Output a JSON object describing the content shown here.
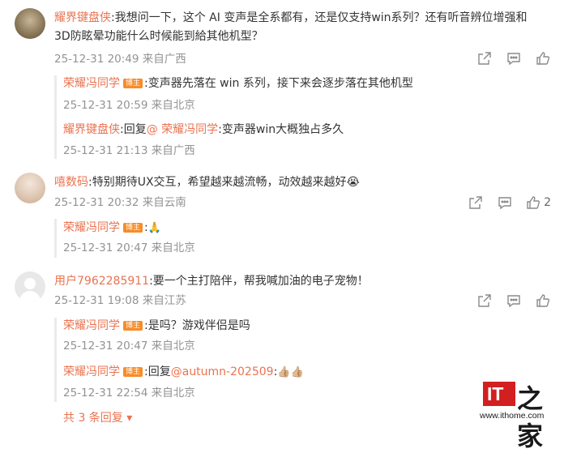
{
  "comments": [
    {
      "user": "耀界键盘侠",
      "text_line1": "我想问一下，这个 AI 变声是全系都有，还是仅支持win系列？还有听音辨位增强和",
      "text_line2": "3D防眩晕功能什么时候能到給其他机型？",
      "meta": "25-12-31 20:49 来自广西",
      "replies": [
        {
          "user": "荣耀冯同学",
          "badge": "博主",
          "text": "变声器先落在 win 系列，接下来会逐步落在其他机型",
          "meta": "25-12-31 20:59 来自北京"
        },
        {
          "user": "耀界键盘侠",
          "reply_prefix": "回复",
          "mention": "@ 荣耀冯同学",
          "text": "变声器win大概独占多久",
          "meta": "25-12-31 21:13 来自广西"
        }
      ]
    },
    {
      "user": "嘻数码",
      "text": "特别期待UX交互，希望越来越流畅，动效越来越好😭",
      "meta": "25-12-31 20:32 来自云南",
      "like_count": "2",
      "replies": [
        {
          "user": "荣耀冯同学",
          "badge": "博主",
          "text": "🙏",
          "meta": "25-12-31 20:47 来自北京"
        }
      ]
    },
    {
      "user": "用户7962285911",
      "text": "要一个主打陪伴，帮我喊加油的电子宠物！",
      "meta": "25-12-31 19:08 来自江苏",
      "replies": [
        {
          "user": "荣耀冯同学",
          "badge": "博主",
          "text": "是吗？游戏伴侣是吗",
          "meta": "25-12-31 20:47 来自北京"
        },
        {
          "user": "荣耀冯同学",
          "badge": "博主",
          "reply_prefix": "回复",
          "mention": "@autumn-202509",
          "text": "👍🏼👍🏼",
          "meta": "25-12-31 22:54 来自北京"
        }
      ],
      "more_replies": "共 3 条回复 ▾"
    }
  ],
  "watermark": {
    "mark": "IT",
    "zh": "之家",
    "url": "www.ithome.com"
  },
  "icons": [
    "share-icon",
    "comment-icon",
    "like-icon"
  ]
}
